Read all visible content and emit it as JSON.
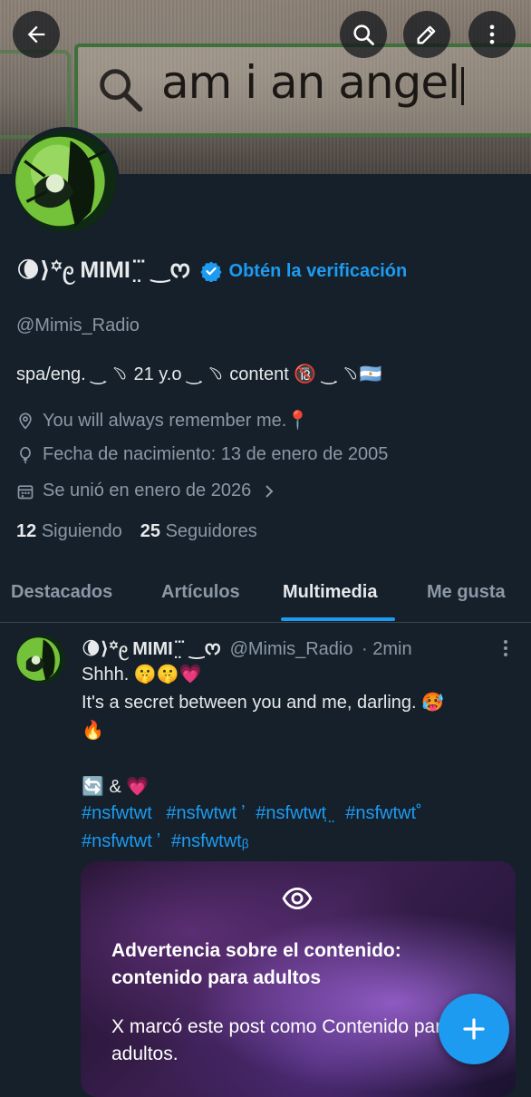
{
  "banner": {
    "search_text": "am i an angel"
  },
  "header": {
    "icons": {
      "back": "arrow-left-icon",
      "search": "search-icon",
      "edit": "pencil-icon",
      "more": "more-vertical-icon"
    }
  },
  "profile": {
    "display_name": "🌘⟩꙳᧙ MIMI ̤  ⃛ ‿ᰔ",
    "verified_icon": "verified-badge-icon",
    "get_verified_label": "Obtén la verificación",
    "handle": "@Mimis_Radio",
    "bio": "spa/eng. ‿ ̣﹆ 21 y.o ‿ ̣﹆ content 🔞 ‿ ̣﹆🇦🇷",
    "location": "You will always remember me.📍",
    "birthday": "Fecha de nacimiento: 13 de enero de 2005",
    "joined": "Se unió en enero de 2026",
    "following_count": "12",
    "following_label": "Siguiendo",
    "followers_count": "25",
    "followers_label": "Seguidores"
  },
  "tabs": [
    {
      "label": "Destacados"
    },
    {
      "label": "Artículos"
    },
    {
      "label": "Multimedia",
      "active": true
    },
    {
      "label": "Me gusta"
    }
  ],
  "post": {
    "author_name": "🌘⟩꙳᧙ MIMI ̤  ⃛ ‿ᰔ",
    "author_handle": "@Mimis_Radio",
    "time": "· 2min",
    "lines": [
      "Shhh. 🤫🤫💗",
      "It's a secret between you and me, darling. 🥵",
      "🔥",
      "",
      "🔄 & 💗"
    ],
    "hashtags_line1": [
      "#nsfwtwt",
      "#nsfwtwt ̛",
      "#nsfwtwt ̤̣",
      "#nsfwtwt˚"
    ],
    "hashtags_line2": [
      "#nsfwtwt ̛",
      "#nsfwtwtᵦ"
    ],
    "warning_title": "Advertencia sobre el contenido: contenido para adultos",
    "warning_text": "X marcó este post como Contenido para adultos."
  },
  "colors": {
    "accent": "#1d9bf0",
    "background": "#15202b",
    "secondary_text": "#8b98a5",
    "divider": "#38444d"
  }
}
